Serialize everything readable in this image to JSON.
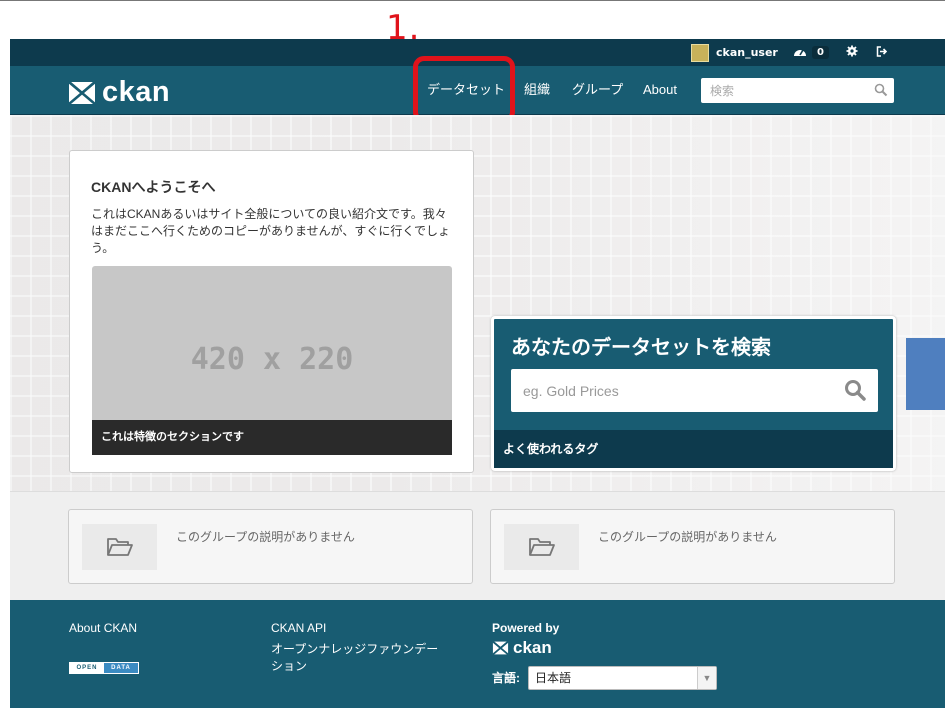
{
  "annotation": {
    "number": "1."
  },
  "account": {
    "username": "ckan_user",
    "activity_count": "0"
  },
  "brand": {
    "logo_text": "ckan"
  },
  "nav": {
    "items": [
      "データセット",
      "組織",
      "グループ",
      "About"
    ]
  },
  "header_search": {
    "placeholder": "検索"
  },
  "welcome": {
    "title": "CKANへようこそへ",
    "text": "これはCKANあるいはサイト全般についての良い紹介文です。我々はまだここへ行くためのコピーがありませんが、すぐに行くでしょう。",
    "image_placeholder": "420 x 220",
    "caption": "これは特徴のセクションです"
  },
  "dataset_search": {
    "title": "あなたのデータセットを検索",
    "placeholder": "eg. Gold Prices",
    "tags_label": "よく使われるタグ"
  },
  "groups": [
    {
      "description": "このグループの説明がありません"
    },
    {
      "description": "このグループの説明がありません"
    }
  ],
  "footer": {
    "about": "About CKAN",
    "api": "CKAN API",
    "foundation_line1": "オープンナレッジファウンデー",
    "foundation_line2": "ション",
    "opendata_left": "OPEN",
    "opendata_right": "DATA",
    "powered_by": "Powered by",
    "ckan_logo": "ckan",
    "language_label": "言語:",
    "language_value": "日本語"
  },
  "icons": [
    "avatar",
    "dashboard-icon",
    "gear-icon",
    "signout-icon",
    "search-icon",
    "folder-open-icon",
    "caret-down-icon"
  ],
  "colors": {
    "masthead": "#185c72",
    "account_bar": "#0d3a4d",
    "annotation_red": "#e0131b"
  }
}
